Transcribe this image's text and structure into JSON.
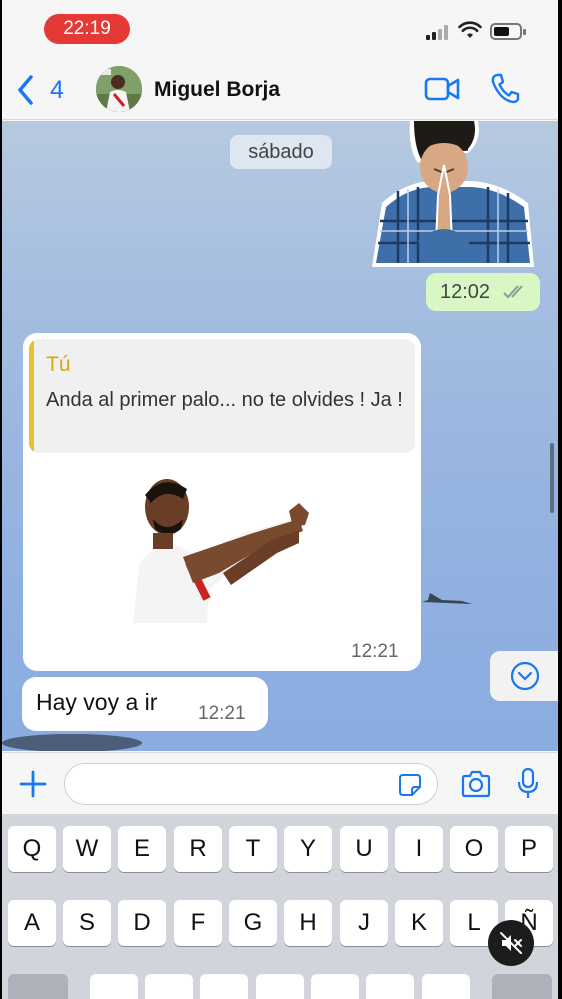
{
  "status_bar": {
    "time": "22:19"
  },
  "header": {
    "back_count": "4",
    "contact_name": "Miguel Borja"
  },
  "chat": {
    "date_separator": "sábado",
    "sent_message": {
      "time": "12:02",
      "status": "read"
    },
    "received_message": {
      "quote_author": "Tú",
      "quote_text": "Anda al primer palo... no te olvides ! Ja !",
      "time": "12:21"
    },
    "received_message_2": {
      "text": "Hay voy a ir",
      "time": "12:21"
    }
  },
  "input": {
    "value": "",
    "placeholder": ""
  },
  "keyboard": {
    "row1": [
      "Q",
      "W",
      "E",
      "R",
      "T",
      "Y",
      "U",
      "I",
      "O",
      "P"
    ],
    "row2": [
      "A",
      "S",
      "D",
      "F",
      "G",
      "H",
      "J",
      "K",
      "L",
      "Ñ"
    ]
  },
  "colors": {
    "accent": "#1877f2",
    "time_pill": "#e53935",
    "sent_bubble": "#d8f7c4",
    "quote_author": "#d8a813",
    "quote_bar": "#e8c22a"
  },
  "icons": {
    "back": "chevron-left-icon",
    "video": "video-camera-icon",
    "call": "phone-icon",
    "ticks": "double-check-icon",
    "scroll": "chevron-down-circle-icon",
    "plus": "plus-icon",
    "sticker": "sticker-icon",
    "camera": "camera-icon",
    "mic": "microphone-icon",
    "mute": "speaker-muted-icon"
  }
}
